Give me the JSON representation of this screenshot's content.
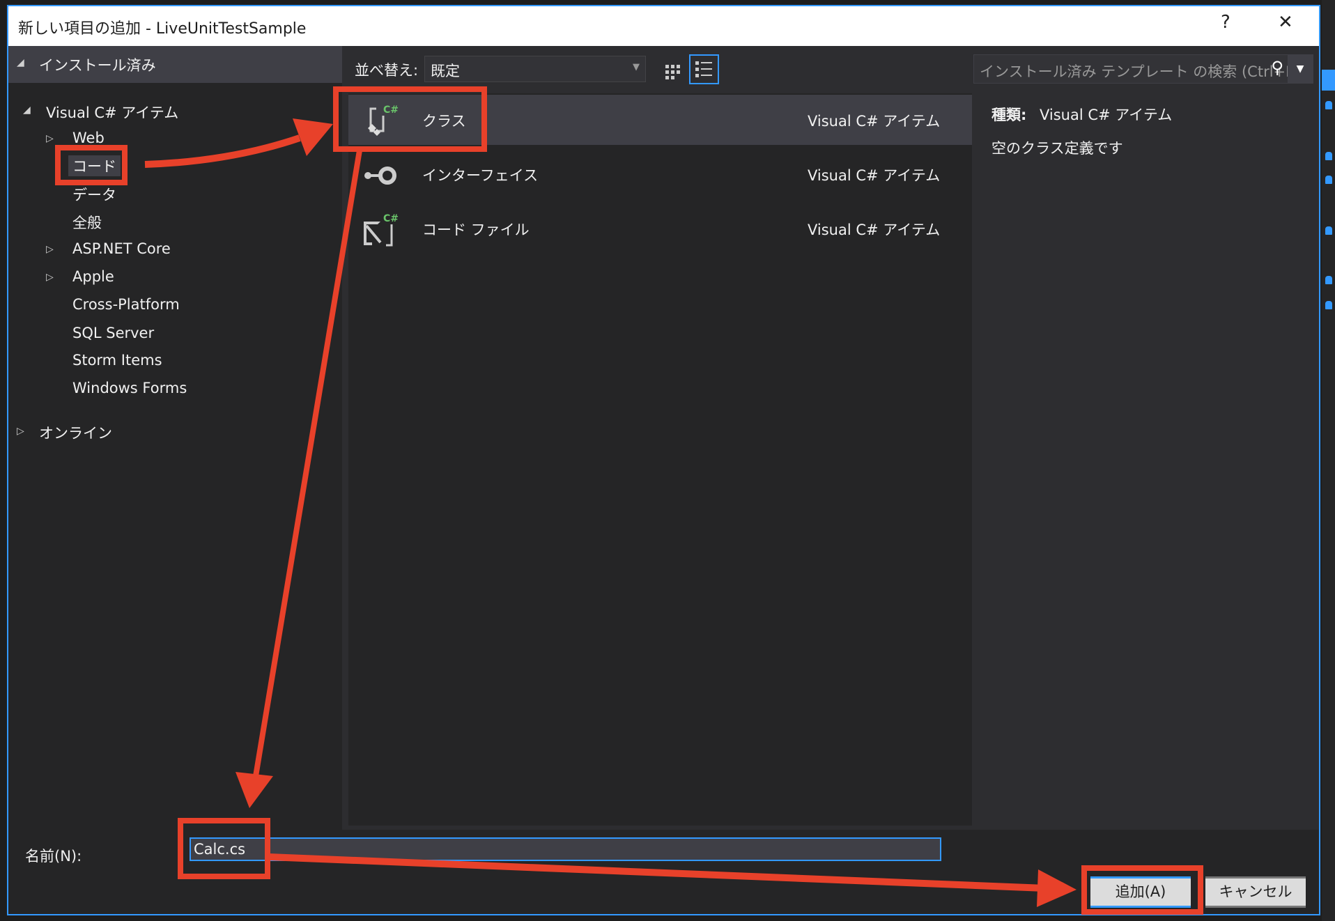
{
  "dialog": {
    "title": "新しい項目の追加 - LiveUnitTestSample",
    "help": "?",
    "close": "✕"
  },
  "tree": {
    "header": "インストール済み",
    "root": "Visual C# アイテム",
    "items": [
      {
        "label": "Web",
        "expandable": true
      },
      {
        "label": "コード",
        "selected": true
      },
      {
        "label": "データ"
      },
      {
        "label": "全般"
      },
      {
        "label": "ASP.NET Core",
        "expandable": true
      },
      {
        "label": "Apple",
        "expandable": true
      },
      {
        "label": "Cross-Platform"
      },
      {
        "label": "SQL Server"
      },
      {
        "label": "Storm Items"
      },
      {
        "label": "Windows Forms"
      }
    ],
    "online": "オンライン"
  },
  "toolbar": {
    "sort_label": "並べ替え:",
    "sort_value": "既定",
    "view_grid": "grid-view-icon",
    "view_list": "list-view-icon"
  },
  "search": {
    "placeholder": "インストール済み テンプレート の検索 (Ctrl+E"
  },
  "templates": [
    {
      "name": "クラス",
      "type": "Visual C# アイテム",
      "icon": "class-icon",
      "selected": true
    },
    {
      "name": "インターフェイス",
      "type": "Visual C# アイテム",
      "icon": "interface-icon"
    },
    {
      "name": "コード ファイル",
      "type": "Visual C# アイテム",
      "icon": "code-file-icon"
    }
  ],
  "details": {
    "kind_label": "種類:",
    "kind_value": "Visual C# アイテム",
    "description": "空のクラス定義です"
  },
  "name_field": {
    "label": "名前(N):",
    "value": "Calc.cs"
  },
  "buttons": {
    "add": "追加(A)",
    "cancel": "キャンセル"
  },
  "colors": {
    "accent": "#3399ff",
    "annotation": "#e8412a",
    "csharp": "#6ac46a"
  }
}
